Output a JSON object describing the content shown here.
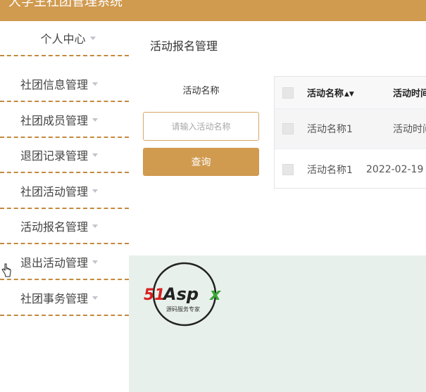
{
  "header": {
    "title": "大学生社团管理系统"
  },
  "sidebar": {
    "items": [
      {
        "label": "个人中心"
      },
      {
        "label": "社团信息管理"
      },
      {
        "label": "社团成员管理"
      },
      {
        "label": "退团记录管理"
      },
      {
        "label": "社团活动管理"
      },
      {
        "label": "活动报名管理"
      },
      {
        "label": "退出活动管理"
      },
      {
        "label": "社团事务管理"
      }
    ]
  },
  "main": {
    "title": "活动报名管理",
    "search": {
      "label": "活动名称",
      "placeholder": "请输入活动名称",
      "button_label": "查询"
    },
    "table": {
      "columns": [
        "活动名称",
        "活动时间"
      ],
      "rows": [
        {
          "name": "活动名称1",
          "time": "活动时间"
        },
        {
          "name": "活动名称1",
          "time": "2022-02-19"
        }
      ]
    }
  },
  "logo": {
    "text": "51Aspx",
    "tagline": "源码服务专家"
  },
  "colors": {
    "accent": "#d09a4f",
    "dashed_border": "#c48a3f",
    "watermark_bg": "#e8f0eb"
  }
}
